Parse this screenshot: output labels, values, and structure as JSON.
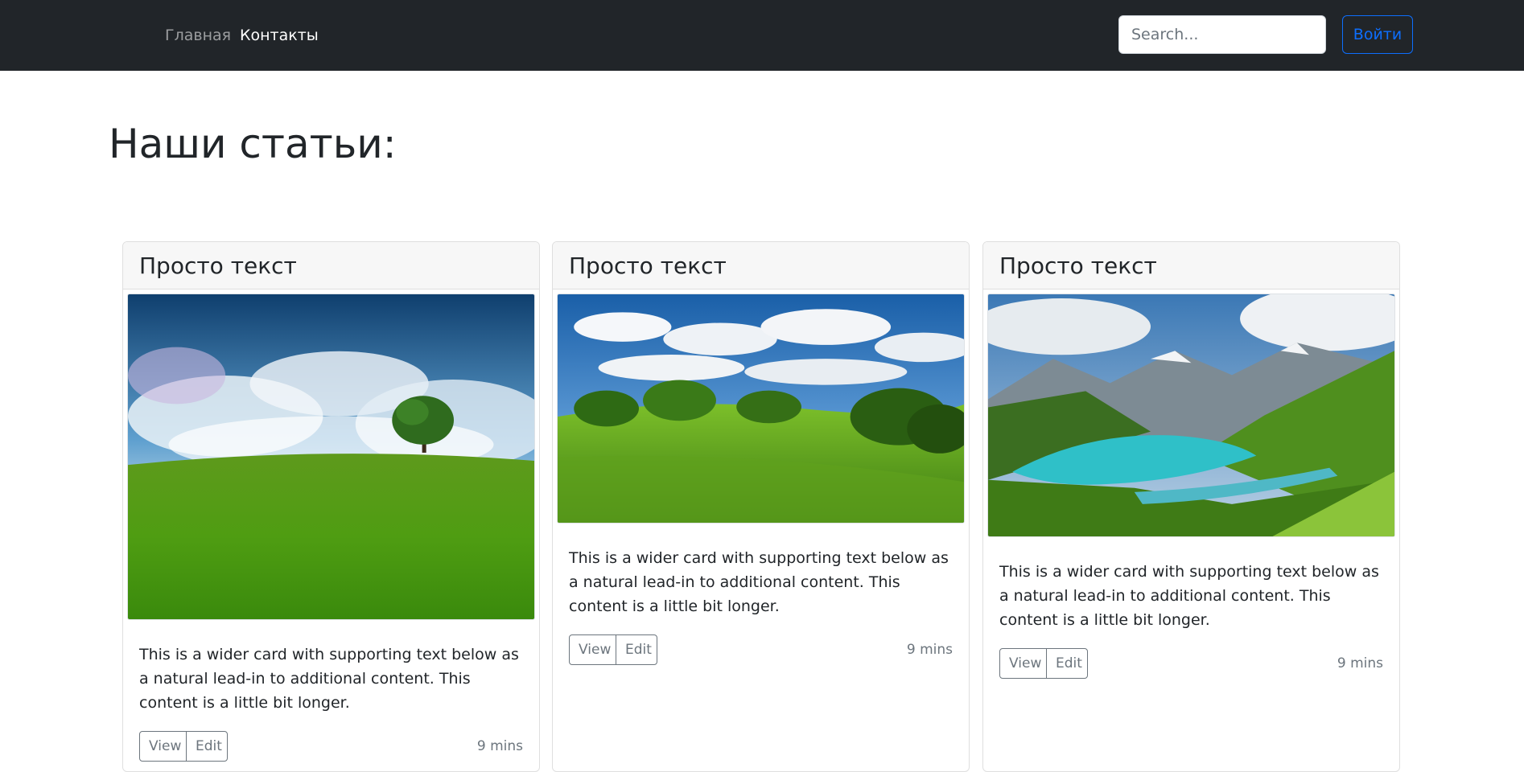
{
  "nav": {
    "home_label": "Главная",
    "contacts_label": "Контакты",
    "search_placeholder": "Search...",
    "login_label": "Войти"
  },
  "main": {
    "title": "Наши статьи:"
  },
  "cards": [
    {
      "title": "Просто текст",
      "image": "landscape-tree-meadow",
      "text": "This is a wider card with supporting text below as a natural lead-in to additional content. This content is a little bit longer.",
      "view_label": "View",
      "edit_label": "Edit",
      "time": "9 mins"
    },
    {
      "title": "Просто текст",
      "image": "landscape-green-hills",
      "text": "This is a wider card with supporting text below as a natural lead-in to additional content. This content is a little bit longer.",
      "view_label": "View",
      "edit_label": "Edit",
      "time": "9 mins"
    },
    {
      "title": "Просто текст",
      "image": "landscape-mountain-lake",
      "text": "This is a wider card with supporting text below as a natural lead-in to additional content. This content is a little bit longer.",
      "view_label": "View",
      "edit_label": "Edit",
      "time": "9 mins"
    }
  ],
  "colors": {
    "navbar_bg": "#212529",
    "primary": "#0d6efd",
    "secondary": "#6c757d"
  }
}
